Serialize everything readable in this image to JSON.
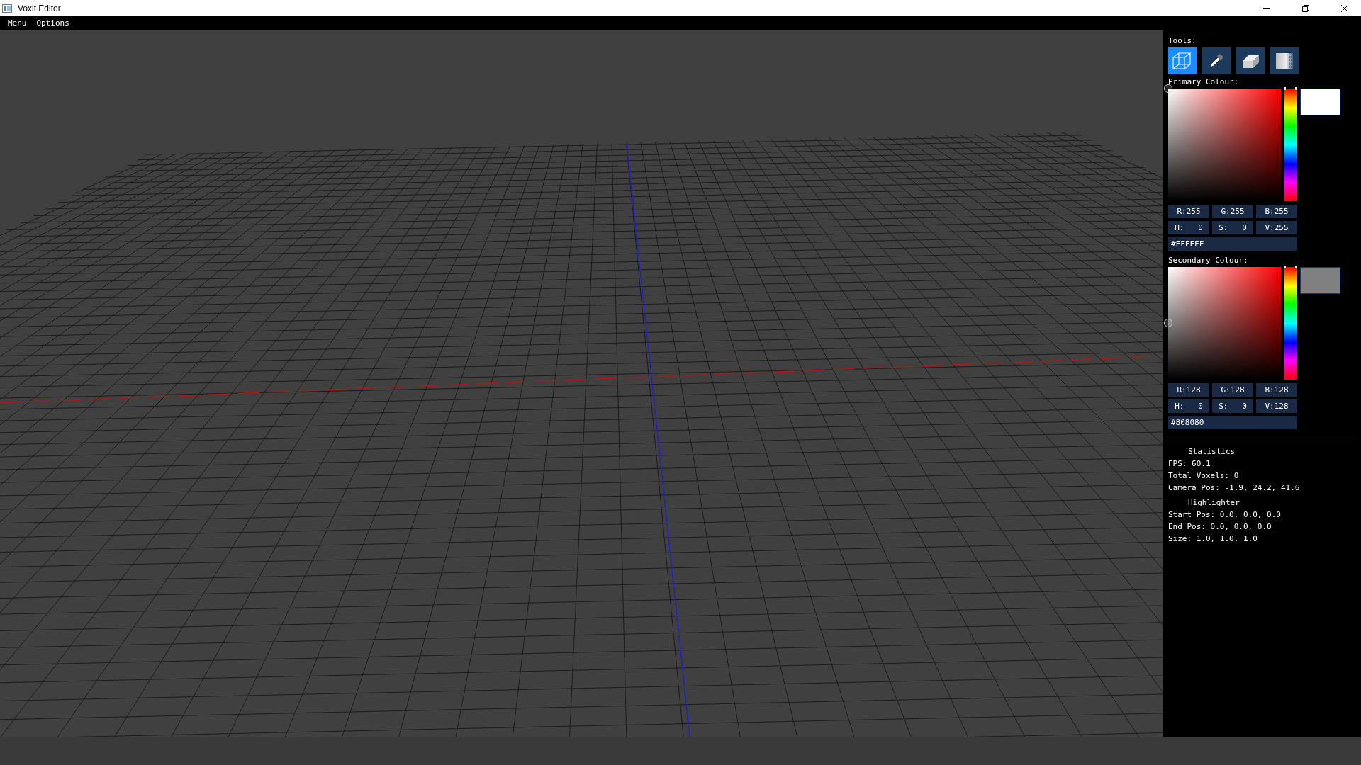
{
  "window": {
    "title": "Voxit Editor"
  },
  "menu_bar": [
    "Menu",
    "Options"
  ],
  "tools": {
    "label": "Tools:",
    "items": [
      {
        "kind": "cube",
        "selected": true
      },
      {
        "kind": "eyedropper",
        "selected": false
      },
      {
        "kind": "eraser",
        "selected": false
      },
      {
        "kind": "gradient",
        "selected": false
      }
    ]
  },
  "colours": [
    {
      "label": "Primary Colour:",
      "hue": {
        "level": 0
      },
      "rgb": [
        "R:255",
        "G:255",
        "B:255"
      ],
      "hsv": [
        "H:   0",
        "S:   0",
        "V:255"
      ],
      "hex": "#FFFFFF"
    },
    {
      "label": "Secondary Colour:",
      "hue": {
        "level": 0
      },
      "rgb": [
        "R:128",
        "G:128",
        "B:128"
      ],
      "hsv": [
        "H:   0",
        "S:   0",
        "V:128"
      ],
      "hex": "#808080"
    }
  ],
  "sections": [
    {
      "heading": "Statistics",
      "lines": [
        "FPS: 60.1",
        "Total Voxels: 0",
        "Camera Pos: -1.9, 24.2, 41.6"
      ]
    },
    {
      "heading": "Highlighter",
      "lines": [
        "Start Pos: 0.0, 0.0, 0.0",
        "End Pos: 0.0, 0.0, 0.0",
        "Size: 1.0, 1.0, 1.0"
      ]
    }
  ]
}
